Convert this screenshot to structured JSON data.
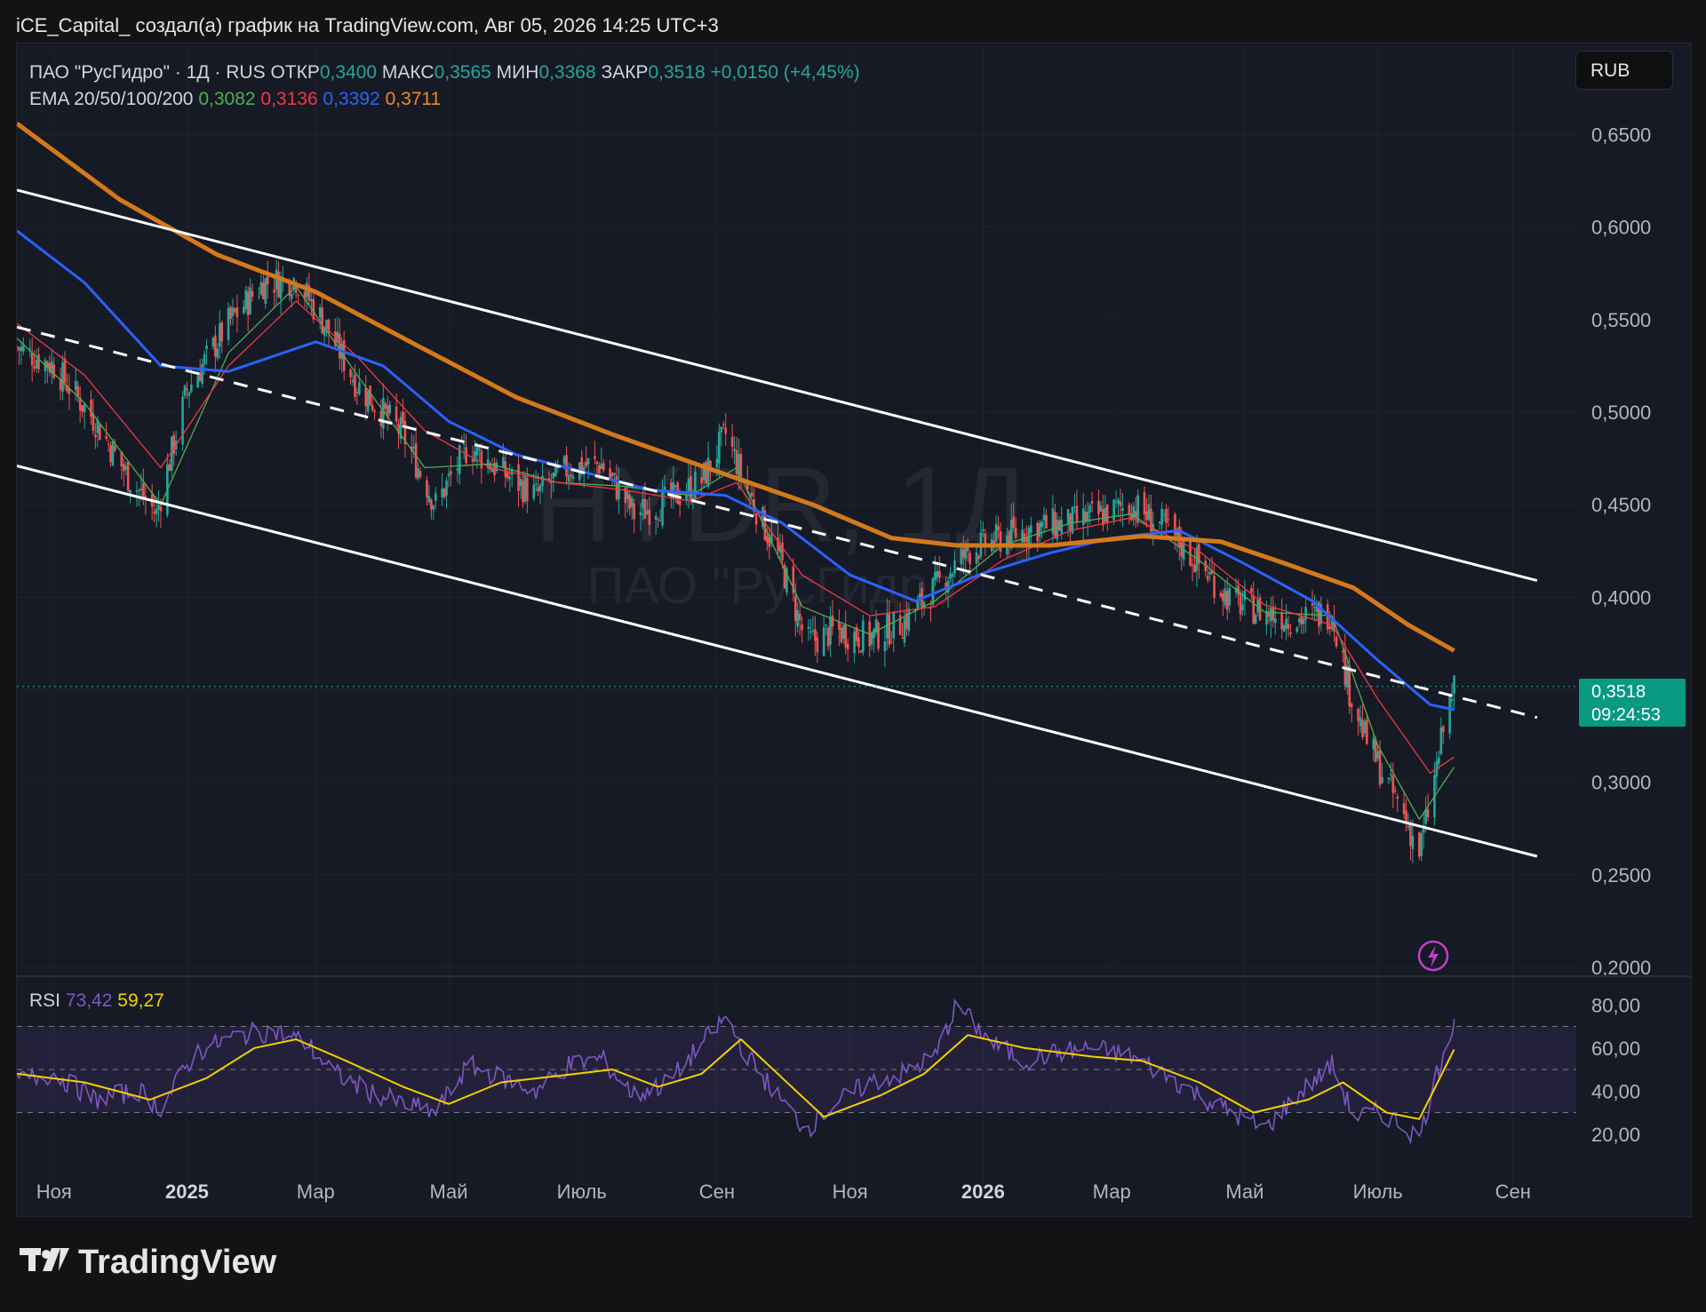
{
  "caption": "iCE_Capital_ создал(а) график на TradingView.com, Авг 05, 2026 14:25 UTC+3",
  "legend": {
    "name": "ПАО \"РусГидро\" · 1Д · RUS",
    "open_label": "ОТКР",
    "open": "0,3400",
    "high_label": "МАКС",
    "high": "0,3565",
    "low_label": "МИН",
    "low": "0,3368",
    "close_label": "ЗАКР",
    "close": "0,3518",
    "change": "+0,0150 (+4,45%)",
    "ema_label": "EMA 20/50/100/200",
    "ema20": "0,3082",
    "ema50": "0,3136",
    "ema100": "0,3392",
    "ema200": "0,3711"
  },
  "currency": "RUB",
  "watermark": {
    "symbol": "HYDR, 1Д",
    "name": "ПАО \"РусГидро\""
  },
  "price_tag": {
    "price": "0,3518",
    "countdown": "09:24:53"
  },
  "rsi_legend": {
    "label": "RSI",
    "rsi": "73,42",
    "ma": "59,27"
  },
  "footer": {
    "brand": "TradingView"
  },
  "colors": {
    "background": "#161a25",
    "up": "#26a69a",
    "down": "#ef5350",
    "ema20": "#4caf50",
    "ema50": "#f23645",
    "ema100": "#2962ff",
    "ema200": "#d4791a",
    "rsi": "#7e57c2",
    "rsi_ma": "#f5d000",
    "channel": "#ffffff",
    "price_tag": "#089981"
  },
  "icons": {
    "alert": "lightning-icon",
    "logo": "tradingview-logo-icon"
  },
  "chart_data": {
    "type": "candlestick",
    "timeframe": "1D",
    "x_range": [
      "2024-10-15",
      "2026-09-30"
    ],
    "ylim": [
      0.2,
      0.68
    ],
    "y_scale": "linear",
    "y_ticks": [
      "0,6500",
      "0,6000",
      "0,5500",
      "0,5000",
      "0,4500",
      "0,4000",
      "0,3500",
      "0,3000",
      "0,2500",
      "0,2000"
    ],
    "x_ticks": [
      {
        "date": "2024-11-01",
        "label": "Ноя"
      },
      {
        "date": "2025-01-01",
        "label": "2025"
      },
      {
        "date": "2025-03-01",
        "label": "Мар"
      },
      {
        "date": "2025-05-01",
        "label": "Май"
      },
      {
        "date": "2025-07-01",
        "label": "Июль"
      },
      {
        "date": "2025-09-01",
        "label": "Сен"
      },
      {
        "date": "2025-11-01",
        "label": "Ноя"
      },
      {
        "date": "2026-01-01",
        "label": "2026"
      },
      {
        "date": "2026-03-01",
        "label": "Мар"
      },
      {
        "date": "2026-05-01",
        "label": "Май"
      },
      {
        "date": "2026-07-01",
        "label": "Июль"
      },
      {
        "date": "2026-09-01",
        "label": "Сен"
      }
    ],
    "last_price": 0.3518,
    "price_path": [
      [
        "2024-10-15",
        0.535
      ],
      [
        "2024-11-01",
        0.525
      ],
      [
        "2024-11-20",
        0.495
      ],
      [
        "2024-12-05",
        0.465
      ],
      [
        "2024-12-18",
        0.445
      ],
      [
        "2025-01-01",
        0.512
      ],
      [
        "2025-01-20",
        0.548
      ],
      [
        "2025-02-05",
        0.57
      ],
      [
        "2025-02-20",
        0.572
      ],
      [
        "2025-03-05",
        0.548
      ],
      [
        "2025-03-20",
        0.515
      ],
      [
        "2025-04-10",
        0.488
      ],
      [
        "2025-04-25",
        0.45
      ],
      [
        "2025-05-10",
        0.482
      ],
      [
        "2025-05-25",
        0.468
      ],
      [
        "2025-06-10",
        0.455
      ],
      [
        "2025-06-25",
        0.47
      ],
      [
        "2025-07-10",
        0.472
      ],
      [
        "2025-07-25",
        0.445
      ],
      [
        "2025-08-10",
        0.452
      ],
      [
        "2025-08-25",
        0.463
      ],
      [
        "2025-09-05",
        0.488
      ],
      [
        "2025-09-15",
        0.458
      ],
      [
        "2025-09-30",
        0.42
      ],
      [
        "2025-10-12",
        0.375
      ],
      [
        "2025-10-25",
        0.382
      ],
      [
        "2025-11-10",
        0.378
      ],
      [
        "2025-11-25",
        0.386
      ],
      [
        "2025-12-10",
        0.405
      ],
      [
        "2025-12-25",
        0.425
      ],
      [
        "2026-01-10",
        0.432
      ],
      [
        "2026-01-25",
        0.438
      ],
      [
        "2026-02-10",
        0.44
      ],
      [
        "2026-02-25",
        0.445
      ],
      [
        "2026-03-10",
        0.45
      ],
      [
        "2026-03-25",
        0.438
      ],
      [
        "2026-04-10",
        0.418
      ],
      [
        "2026-04-25",
        0.398
      ],
      [
        "2026-05-10",
        0.392
      ],
      [
        "2026-05-25",
        0.388
      ],
      [
        "2026-06-10",
        0.392
      ],
      [
        "2026-06-18",
        0.35
      ],
      [
        "2026-06-25",
        0.325
      ],
      [
        "2026-07-05",
        0.3
      ],
      [
        "2026-07-12",
        0.285
      ],
      [
        "2026-07-20",
        0.262
      ],
      [
        "2026-07-26",
        0.295
      ],
      [
        "2026-08-01",
        0.335
      ],
      [
        "2026-08-05",
        0.3518
      ]
    ],
    "ema200_path": [
      [
        "2024-10-15",
        0.656
      ],
      [
        "2024-12-01",
        0.615
      ],
      [
        "2025-01-15",
        0.585
      ],
      [
        "2025-03-01",
        0.565
      ],
      [
        "2025-04-15",
        0.537
      ],
      [
        "2025-06-01",
        0.508
      ],
      [
        "2025-07-15",
        0.488
      ],
      [
        "2025-09-01",
        0.468
      ],
      [
        "2025-10-15",
        0.45
      ],
      [
        "2025-11-20",
        0.432
      ],
      [
        "2025-12-20",
        0.428
      ],
      [
        "2026-02-01",
        0.428
      ],
      [
        "2026-03-15",
        0.433
      ],
      [
        "2026-04-20",
        0.43
      ],
      [
        "2026-05-20",
        0.418
      ],
      [
        "2026-06-20",
        0.405
      ],
      [
        "2026-07-15",
        0.385
      ],
      [
        "2026-08-05",
        0.3711
      ]
    ],
    "ema100_path": [
      [
        "2024-10-15",
        0.598
      ],
      [
        "2024-11-15",
        0.57
      ],
      [
        "2024-12-20",
        0.525
      ],
      [
        "2025-01-20",
        0.522
      ],
      [
        "2025-03-01",
        0.538
      ],
      [
        "2025-04-01",
        0.525
      ],
      [
        "2025-05-01",
        0.495
      ],
      [
        "2025-06-01",
        0.477
      ],
      [
        "2025-07-01",
        0.468
      ],
      [
        "2025-08-01",
        0.458
      ],
      [
        "2025-09-05",
        0.455
      ],
      [
        "2025-10-01",
        0.44
      ],
      [
        "2025-11-01",
        0.412
      ],
      [
        "2025-12-01",
        0.398
      ],
      [
        "2026-01-01",
        0.413
      ],
      [
        "2026-02-01",
        0.424
      ],
      [
        "2026-03-01",
        0.432
      ],
      [
        "2026-04-01",
        0.436
      ],
      [
        "2026-05-01",
        0.418
      ],
      [
        "2026-06-01",
        0.398
      ],
      [
        "2026-07-01",
        0.366
      ],
      [
        "2026-07-25",
        0.342
      ],
      [
        "2026-08-05",
        0.3392
      ]
    ],
    "ema50_path": [
      [
        "2024-10-15",
        0.548
      ],
      [
        "2024-11-15",
        0.52
      ],
      [
        "2024-12-20",
        0.47
      ],
      [
        "2025-01-20",
        0.525
      ],
      [
        "2025-02-20",
        0.56
      ],
      [
        "2025-03-20",
        0.53
      ],
      [
        "2025-04-20",
        0.49
      ],
      [
        "2025-05-20",
        0.47
      ],
      [
        "2025-06-20",
        0.462
      ],
      [
        "2025-07-20",
        0.458
      ],
      [
        "2025-08-20",
        0.452
      ],
      [
        "2025-09-10",
        0.462
      ],
      [
        "2025-10-10",
        0.412
      ],
      [
        "2025-11-10",
        0.39
      ],
      [
        "2025-12-10",
        0.395
      ],
      [
        "2026-01-10",
        0.42
      ],
      [
        "2026-02-10",
        0.436
      ],
      [
        "2026-03-10",
        0.443
      ],
      [
        "2026-04-10",
        0.425
      ],
      [
        "2026-05-10",
        0.396
      ],
      [
        "2026-06-10",
        0.385
      ],
      [
        "2026-07-01",
        0.345
      ],
      [
        "2026-07-25",
        0.305
      ],
      [
        "2026-08-05",
        0.3136
      ]
    ],
    "ema20_path": [
      [
        "2024-10-15",
        0.54
      ],
      [
        "2024-11-15",
        0.505
      ],
      [
        "2024-12-20",
        0.45
      ],
      [
        "2025-01-20",
        0.532
      ],
      [
        "2025-02-20",
        0.568
      ],
      [
        "2025-03-20",
        0.52
      ],
      [
        "2025-04-20",
        0.47
      ],
      [
        "2025-05-20",
        0.472
      ],
      [
        "2025-06-20",
        0.462
      ],
      [
        "2025-07-20",
        0.46
      ],
      [
        "2025-08-20",
        0.455
      ],
      [
        "2025-09-10",
        0.47
      ],
      [
        "2025-10-10",
        0.395
      ],
      [
        "2025-11-10",
        0.38
      ],
      [
        "2025-12-10",
        0.398
      ],
      [
        "2026-01-10",
        0.428
      ],
      [
        "2026-02-10",
        0.44
      ],
      [
        "2026-03-10",
        0.445
      ],
      [
        "2026-04-10",
        0.42
      ],
      [
        "2026-05-10",
        0.392
      ],
      [
        "2026-06-10",
        0.39
      ],
      [
        "2026-07-01",
        0.32
      ],
      [
        "2026-07-20",
        0.28
      ],
      [
        "2026-08-05",
        0.3082
      ]
    ],
    "channel": {
      "upper": [
        [
          "2024-10-15",
          0.62
        ],
        [
          "2026-09-12",
          0.409
        ]
      ],
      "lower": [
        [
          "2024-10-15",
          0.471
        ],
        [
          "2026-09-12",
          0.26
        ]
      ],
      "middle": [
        [
          "2024-10-15",
          0.546
        ],
        [
          "2026-09-12",
          0.335
        ]
      ]
    },
    "rsi": {
      "ylim": [
        10,
        90
      ],
      "y_ticks": [
        "80,00",
        "60,00",
        "40,00",
        "20,00"
      ],
      "levels": [
        70,
        50,
        30
      ],
      "rsi_path": [
        [
          "2024-10-15",
          45
        ],
        [
          "2024-11-01",
          48
        ],
        [
          "2024-11-20",
          36
        ],
        [
          "2024-12-10",
          40
        ],
        [
          "2024-12-20",
          32
        ],
        [
          "2025-01-05",
          58
        ],
        [
          "2025-01-25",
          66
        ],
        [
          "2025-02-10",
          68
        ],
        [
          "2025-02-25",
          62
        ],
        [
          "2025-03-10",
          48
        ],
        [
          "2025-03-25",
          40
        ],
        [
          "2025-04-10",
          34
        ],
        [
          "2025-04-25",
          30
        ],
        [
          "2025-05-10",
          52
        ],
        [
          "2025-05-25",
          46
        ],
        [
          "2025-06-10",
          40
        ],
        [
          "2025-06-25",
          52
        ],
        [
          "2025-07-10",
          55
        ],
        [
          "2025-07-25",
          38
        ],
        [
          "2025-08-10",
          44
        ],
        [
          "2025-08-25",
          62
        ],
        [
          "2025-09-05",
          74
        ],
        [
          "2025-09-15",
          56
        ],
        [
          "2025-09-30",
          36
        ],
        [
          "2025-10-12",
          22
        ],
        [
          "2025-10-25",
          34
        ],
        [
          "2025-11-10",
          44
        ],
        [
          "2025-11-25",
          48
        ],
        [
          "2025-12-10",
          56
        ],
        [
          "2025-12-20",
          80
        ],
        [
          "2026-01-05",
          62
        ],
        [
          "2026-01-20",
          54
        ],
        [
          "2026-02-05",
          58
        ],
        [
          "2026-02-20",
          60
        ],
        [
          "2026-03-10",
          56
        ],
        [
          "2026-03-25",
          48
        ],
        [
          "2026-04-10",
          38
        ],
        [
          "2026-04-25",
          30
        ],
        [
          "2026-05-10",
          22
        ],
        [
          "2026-05-25",
          38
        ],
        [
          "2026-06-10",
          52
        ],
        [
          "2026-06-20",
          28
        ],
        [
          "2026-07-01",
          30
        ],
        [
          "2026-07-10",
          26
        ],
        [
          "2026-07-20",
          18
        ],
        [
          "2026-07-28",
          48
        ],
        [
          "2026-08-05",
          73.42
        ]
      ],
      "ma_path": [
        [
          "2024-10-15",
          48
        ],
        [
          "2024-11-15",
          44
        ],
        [
          "2024-12-15",
          36
        ],
        [
          "2025-01-10",
          46
        ],
        [
          "2025-02-01",
          60
        ],
        [
          "2025-02-20",
          64
        ],
        [
          "2025-03-15",
          54
        ],
        [
          "2025-04-10",
          42
        ],
        [
          "2025-05-01",
          34
        ],
        [
          "2025-05-25",
          44
        ],
        [
          "2025-06-20",
          47
        ],
        [
          "2025-07-15",
          50
        ],
        [
          "2025-08-05",
          42
        ],
        [
          "2025-08-25",
          48
        ],
        [
          "2025-09-12",
          64
        ],
        [
          "2025-10-01",
          46
        ],
        [
          "2025-10-20",
          28
        ],
        [
          "2025-11-15",
          38
        ],
        [
          "2025-12-05",
          48
        ],
        [
          "2025-12-25",
          66
        ],
        [
          "2026-01-20",
          60
        ],
        [
          "2026-02-20",
          56
        ],
        [
          "2026-03-15",
          54
        ],
        [
          "2026-04-10",
          44
        ],
        [
          "2026-05-05",
          30
        ],
        [
          "2026-05-30",
          36
        ],
        [
          "2026-06-15",
          44
        ],
        [
          "2026-07-05",
          30
        ],
        [
          "2026-07-20",
          27
        ],
        [
          "2026-08-05",
          59.27
        ]
      ]
    }
  }
}
